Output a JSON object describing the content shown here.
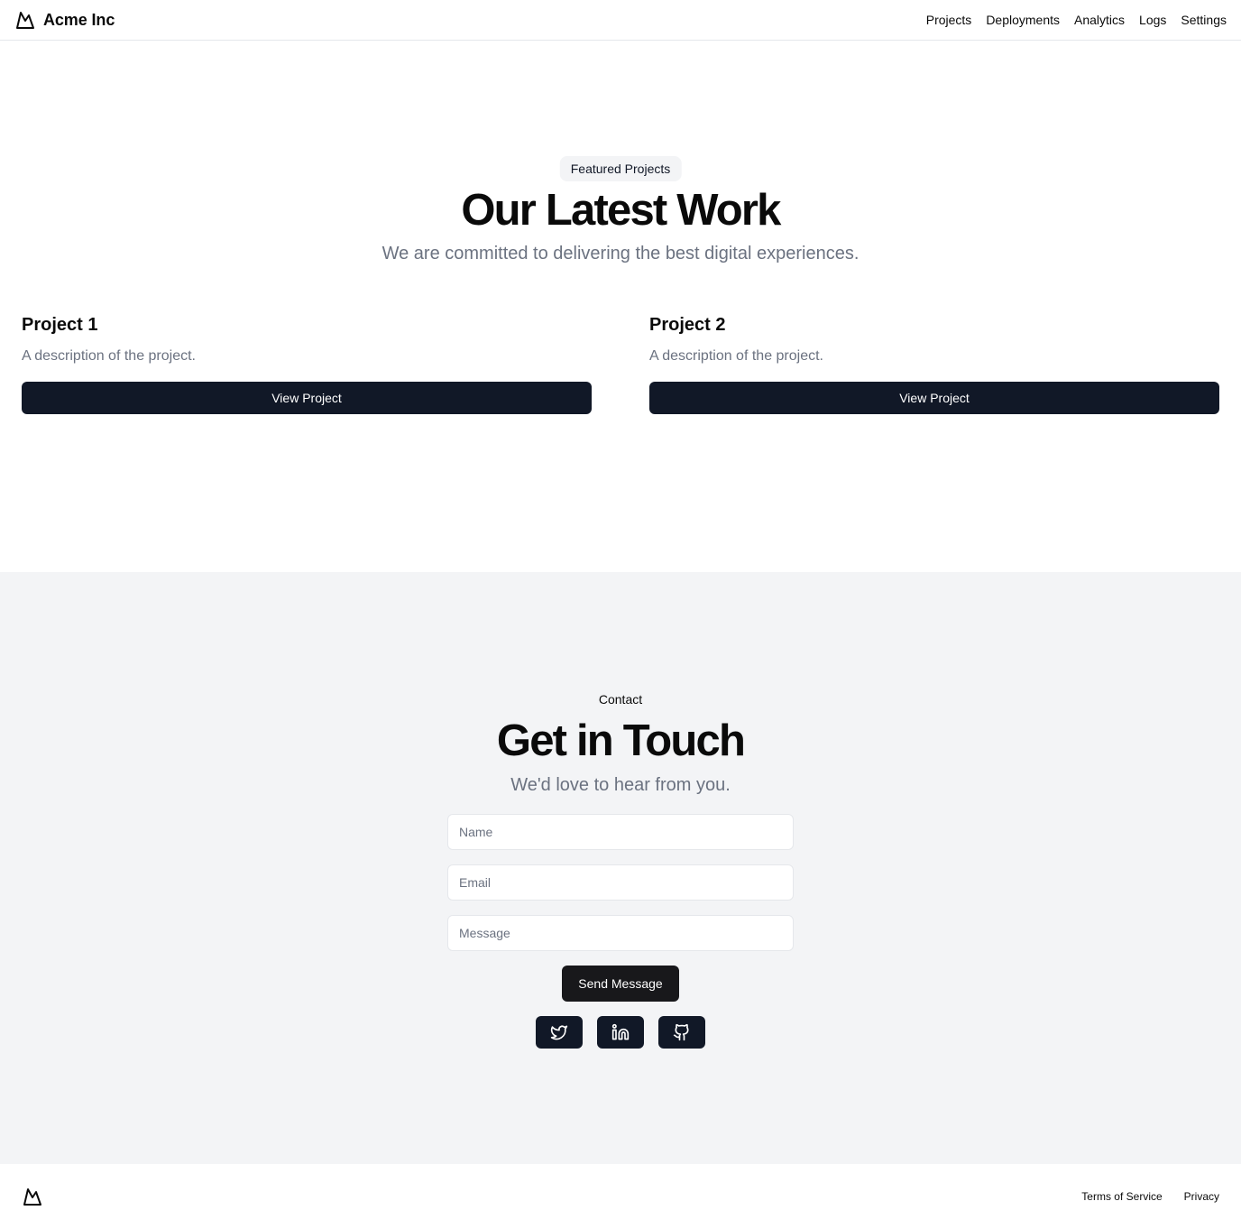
{
  "header": {
    "brand_name": "Acme Inc",
    "logo_icon": "mountain-icon",
    "nav": [
      "Projects",
      "Deployments",
      "Analytics",
      "Logs",
      "Settings"
    ]
  },
  "projects_section": {
    "badge": "Featured Projects",
    "title": "Our Latest Work",
    "subtitle": "We are committed to delivering the best digital experiences.",
    "cards": [
      {
        "title": "Project 1",
        "description": "A description of the project.",
        "button": "View Project"
      },
      {
        "title": "Project 2",
        "description": "A description of the project.",
        "button": "View Project"
      }
    ]
  },
  "contact_section": {
    "label": "Contact",
    "title": "Get in Touch",
    "subtitle": "We'd love to hear from you.",
    "form": {
      "name_placeholder": "Name",
      "email_placeholder": "Email",
      "message_placeholder": "Message",
      "name_value": "",
      "email_value": "",
      "message_value": "",
      "submit_label": "Send Message"
    },
    "social_icons": [
      "twitter-icon",
      "linkedin-icon",
      "github-icon"
    ]
  },
  "footer": {
    "logo_icon": "mountain-icon",
    "links": [
      "Terms of Service",
      "Privacy"
    ]
  },
  "colors": {
    "text": "#0a0a0a",
    "muted_text": "#6b7280",
    "button_bg": "#111827",
    "contact_bg": "#f3f4f6",
    "border": "#e5e7eb"
  }
}
